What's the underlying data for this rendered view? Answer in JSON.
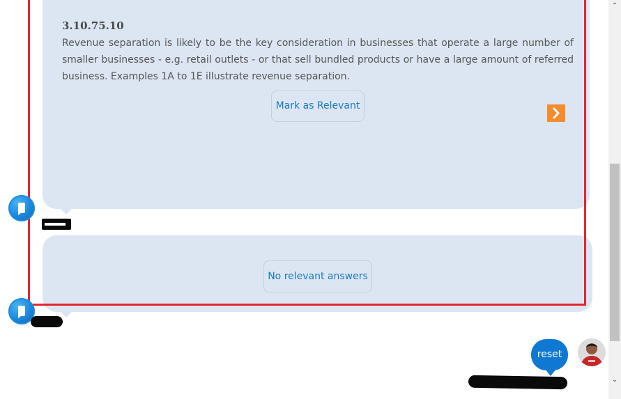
{
  "conversation": {
    "reference_card": {
      "title": "3.10.75.10",
      "body": "Revenue separation is likely to be the key consideration in businesses that operate a large number of smaller businesses - e.g. retail outlets - or that sell bundled products or have a large amount of referred business. Examples 1A to 1E illustrate revenue separation.",
      "mark_relevant_label": "Mark as Relevant",
      "next_icon": "chevron-right-icon"
    },
    "no_answer_card": {
      "button_label": "No relevant answers"
    },
    "user_message": {
      "text": "reset"
    },
    "bot_avatar_icon": "bot-chat-icon"
  },
  "colors": {
    "bubble_bg": "#dce6f2",
    "accent_blue": "#1a78c2",
    "user_bubble": "#0f78d2",
    "next_button": "#f68b2c",
    "highlight": "#e3262d"
  },
  "scrollbar": {
    "up_arrow": "⌃",
    "down_arrow": "⌄"
  }
}
